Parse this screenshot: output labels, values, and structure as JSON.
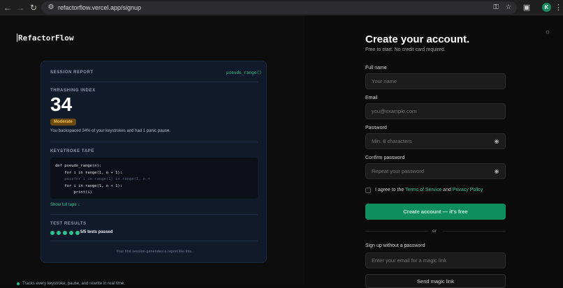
{
  "browser": {
    "url": "refactorflow.vercel.app/signup",
    "profile_initial": "K",
    "icons": [
      "back-icon",
      "forward-icon",
      "reload-icon",
      "site-settings-icon",
      "password-key-icon",
      "bookmark-star-icon",
      "extensions-icon",
      "menu-kebab-icon"
    ]
  },
  "brand": {
    "name": "RefactorFlow"
  },
  "report": {
    "title": "SESSION REPORT",
    "function_tag": "pseudo_range()",
    "thrashing_label": "THRASHING INDEX",
    "thrashing_value": "34",
    "badge": "Moderate",
    "description": "You backspaced 34% of your keystrokes and had 1 panic pause.",
    "tape_label": "KEYSTROKE TAPE",
    "code_lines": [
      "def pseudo_range(n):",
      "    for i in range(1, n + 1):",
      "    passfor i in range(1) in range(1, n +",
      "    for i in range(1, n + 1):",
      "        print(i)"
    ],
    "show_tape": "Show full tape ↓",
    "tests_label": "TEST RESULTS",
    "tests_summary": "5/5 tests passed",
    "tests_passed": 5,
    "tests_total": 5,
    "footer": "Your first session generates a report like this.",
    "accent_color": "#2fbf8e",
    "badge_color": "#f6c15a"
  },
  "bottom_note": "Tracks every keystroke, pause, and rewrite in real time.",
  "form": {
    "title": "Create your account.",
    "subtitle": "Free to start. No credit card required.",
    "full_name_label": "Full name",
    "full_name_placeholder": "Your name",
    "email_label": "Email",
    "email_placeholder": "you@example.com",
    "password_label": "Password",
    "password_placeholder": "Min. 8 characters",
    "confirm_label": "Confirm password",
    "confirm_placeholder": "Repeat your password",
    "agree_prefix": "I agree to the",
    "terms_link": "Terms of Service",
    "agree_and": "and",
    "privacy_link": "Privacy Policy",
    "create_button": "Create account — it's free",
    "or": "or",
    "magic_label": "Sign up without a password",
    "magic_placeholder": "Enter your email for a magic link",
    "magic_button": "Send magic link",
    "primary_color": "#0f8f5f"
  }
}
